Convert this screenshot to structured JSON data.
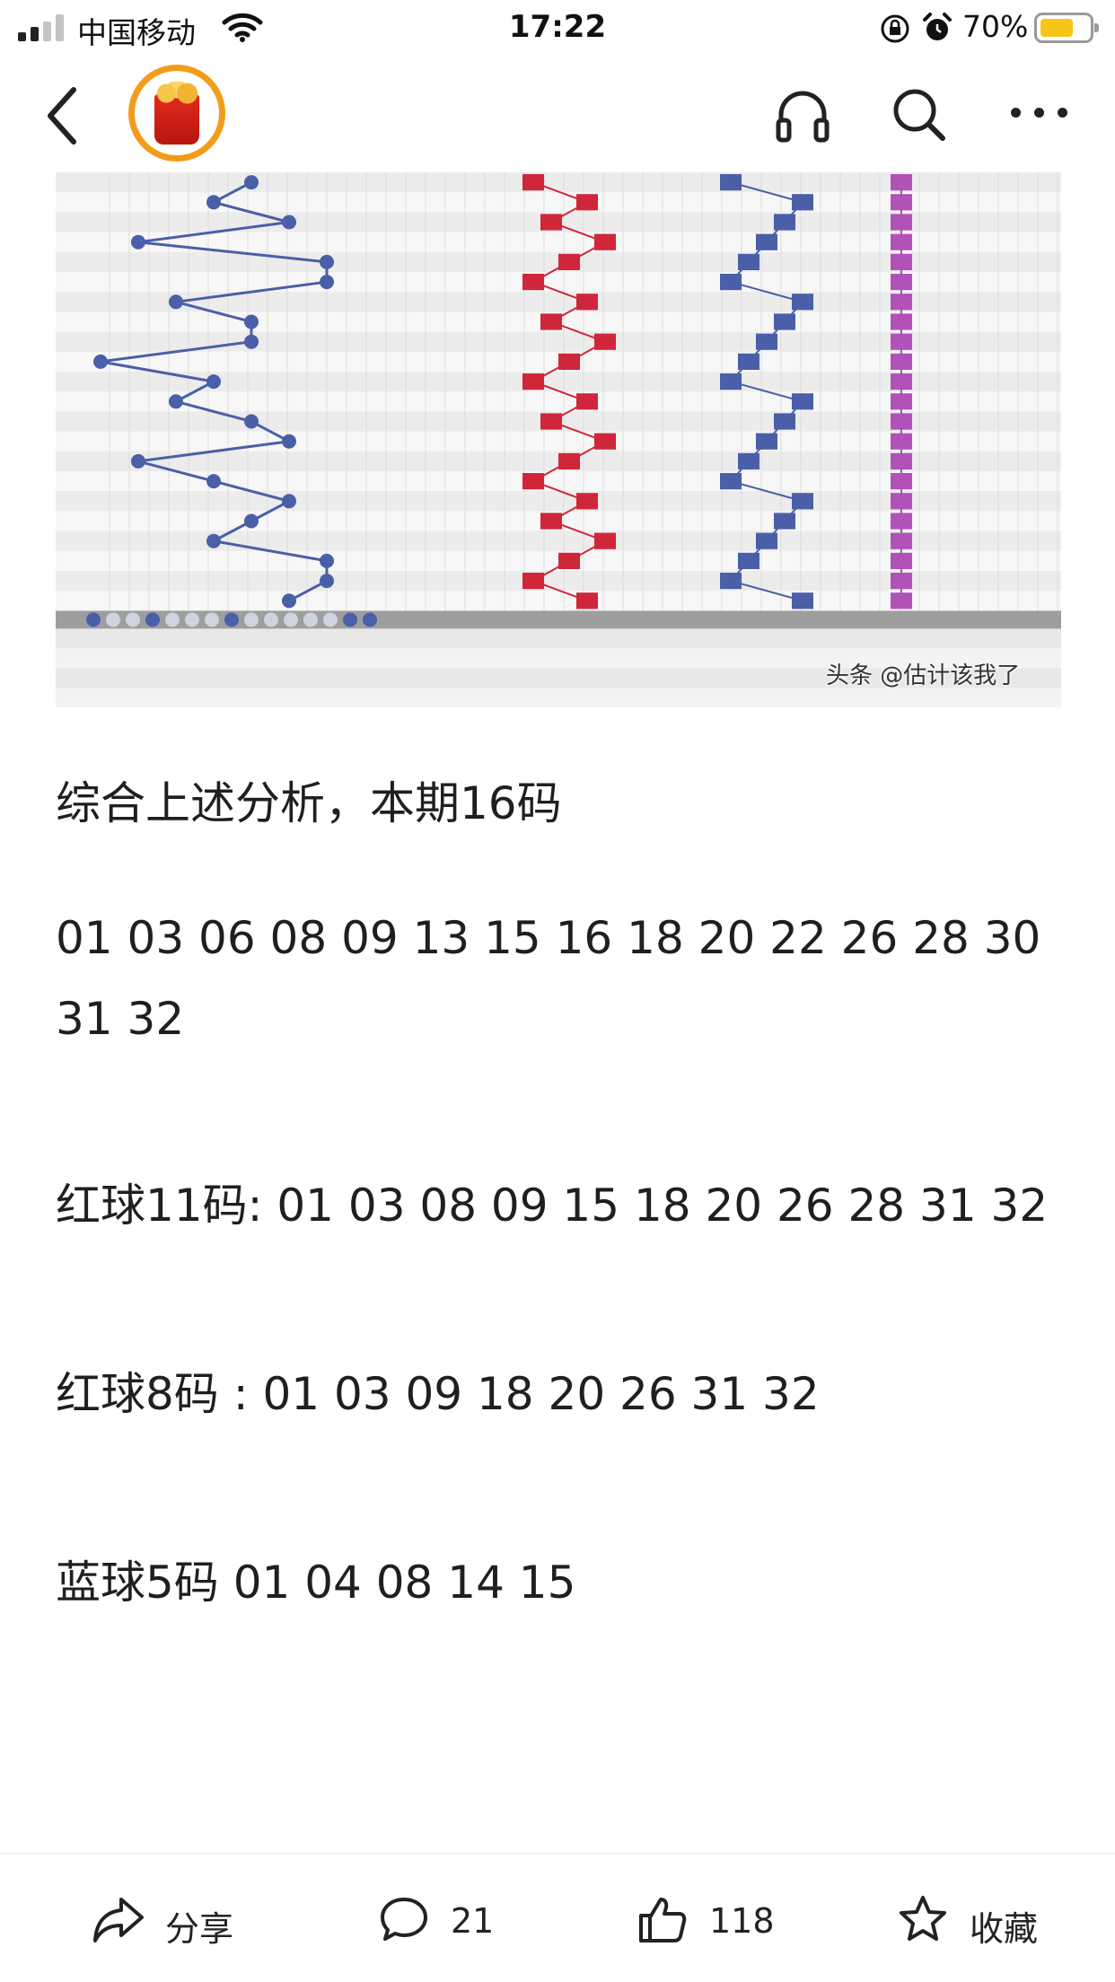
{
  "status_bar": {
    "carrier": "中国移动",
    "time": "17:22",
    "battery_percent": "70%",
    "battery_level": 0.7,
    "signal_bars": 2,
    "icons": [
      "signal-icon",
      "wifi-icon",
      "rotation-lock-icon",
      "alarm-icon",
      "battery-icon"
    ]
  },
  "nav_bar": {
    "icons": [
      "back-icon",
      "avatar",
      "headphones-icon",
      "search-icon",
      "more-icon"
    ]
  },
  "chart_image": {
    "watermark": "头条 @估计该我了",
    "colors": {
      "blue": "#4a5fa8",
      "red": "#d0263a",
      "magenta": "#b052b8"
    }
  },
  "article": {
    "p1": "综合上述分析，本期16码",
    "p2": "01 03 06 08 09 13 15 16 18 20 22 26 28 30 31 32",
    "p3": "红球11码: 01 03 08 09 15 18 20 26 28 31 32",
    "p4": "红球8码 : 01 03 09 18 20 26 31 32",
    "p5": "蓝球5码 01 04 08 14 15"
  },
  "bottom_bar": {
    "share_label": "分享",
    "comment_count": "21",
    "like_count": "118",
    "favorite_label": "收藏"
  }
}
